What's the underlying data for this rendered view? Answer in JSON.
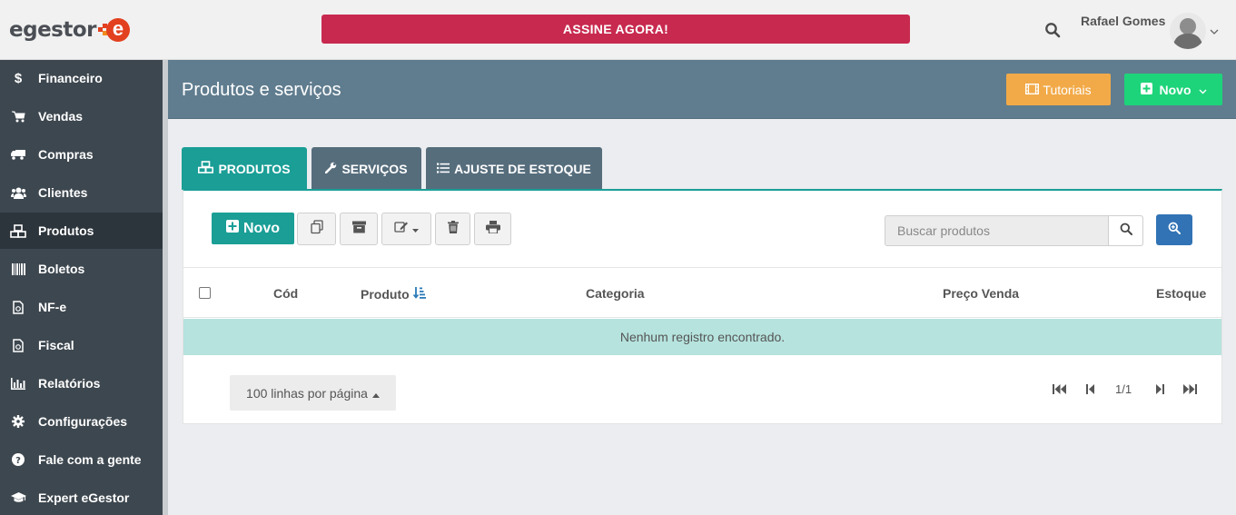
{
  "brand": {
    "logo_text": "egestor",
    "logo_mark": "e"
  },
  "topbar": {
    "cta_label": "ASSINE AGORA!",
    "search_icon": "search-icon",
    "user_name": "Rafael Gomes"
  },
  "sidebar": {
    "items": [
      {
        "label": "Financeiro",
        "icon": "dollar-icon"
      },
      {
        "label": "Vendas",
        "icon": "cart-icon"
      },
      {
        "label": "Compras",
        "icon": "truck-icon"
      },
      {
        "label": "Clientes",
        "icon": "users-icon"
      },
      {
        "label": "Produtos",
        "icon": "cubes-icon",
        "active": true
      },
      {
        "label": "Boletos",
        "icon": "barcode-icon"
      },
      {
        "label": "NF-e",
        "icon": "file-icon"
      },
      {
        "label": "Fiscal",
        "icon": "file-icon"
      },
      {
        "label": "Relatórios",
        "icon": "bar-chart-icon"
      },
      {
        "label": "Configurações",
        "icon": "gear-icon"
      },
      {
        "label": "Fale com a gente",
        "icon": "question-icon"
      },
      {
        "label": "Expert eGestor",
        "icon": "graduation-cap-icon"
      }
    ]
  },
  "header": {
    "title": "Produtos e serviços",
    "tutorials_label": "Tutoriais",
    "new_label": "Novo"
  },
  "tabs": [
    {
      "label": "PRODUTOS",
      "icon": "cubes-icon",
      "active": true
    },
    {
      "label": "SERVIÇOS",
      "icon": "wrench-icon"
    },
    {
      "label": "AJUSTE DE ESTOQUE",
      "icon": "list-icon"
    }
  ],
  "toolbar": {
    "new_label": "Novo",
    "search_placeholder": "Buscar produtos"
  },
  "table": {
    "columns": [
      "Cód",
      "Produto",
      "Categoria",
      "Preço Venda",
      "Estoque"
    ],
    "sorted_column": "Produto",
    "empty_message": "Nenhum registro encontrado."
  },
  "pagination": {
    "per_page_label": "100 linhas por página",
    "page_info": "1/1"
  },
  "colors": {
    "teal": "#1a9e96",
    "cta": "#c8294f",
    "sidebar": "#3d474f",
    "header": "#607d8f",
    "tutorial": "#f2aa48",
    "new": "#1dd47a",
    "empty_row": "#b6e3de"
  }
}
